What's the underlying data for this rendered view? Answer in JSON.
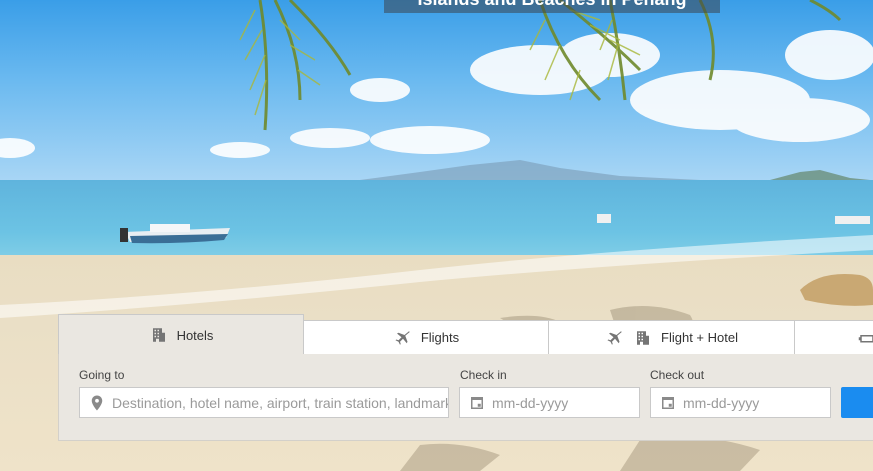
{
  "hero": {
    "title": "Islands and Beaches in Penang"
  },
  "tabs": [
    {
      "label": "Hotels",
      "icon": "building-icon",
      "active": true
    },
    {
      "label": "Flights",
      "icon": "airplane-icon",
      "active": false
    },
    {
      "label": "Flight + Hotel",
      "icon": "airplane-building-icon",
      "active": false
    },
    {
      "label": "",
      "icon": "car-icon",
      "active": false
    }
  ],
  "search": {
    "going_to_label": "Going to",
    "going_to_placeholder": "Destination, hotel name, airport, train station, landmark, or address",
    "check_in_label": "Check in",
    "check_in_placeholder": "mm-dd-yyyy",
    "check_out_label": "Check out",
    "check_out_placeholder": "mm-dd-yyyy",
    "button_color": "#1a8cf0"
  }
}
